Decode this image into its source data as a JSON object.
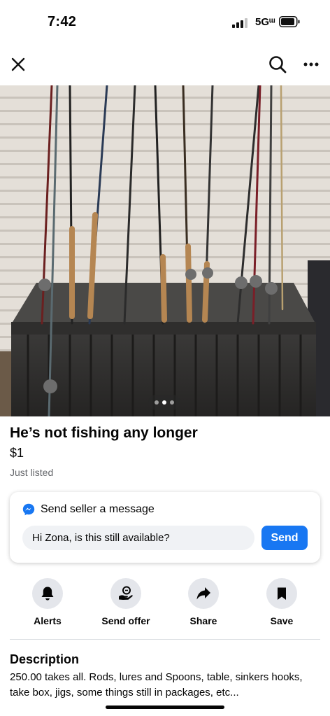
{
  "status_bar": {
    "time": "7:42",
    "network": "5Gᵚ",
    "signal_bars_active": 3,
    "signal_bars_total": 4
  },
  "nav": {
    "close_icon": "close-icon",
    "search_icon": "search-icon",
    "more_icon": "more-options-icon"
  },
  "photo": {
    "page_count": 3,
    "current_page": 2
  },
  "listing": {
    "title": "He’s not fishing any longer",
    "price": "$1",
    "listed": "Just listed"
  },
  "message": {
    "heading": "Send seller a message",
    "input_value": "Hi Zona, is this still available?",
    "send_label": "Send"
  },
  "actions": [
    {
      "label": "Alerts",
      "icon": "bell-icon"
    },
    {
      "label": "Send offer",
      "icon": "offer-icon"
    },
    {
      "label": "Share",
      "icon": "share-arrow-icon"
    },
    {
      "label": "Save",
      "icon": "bookmark-icon"
    }
  ],
  "description": {
    "heading": "Description",
    "text": "250.00 takes all. Rods, lures and Spoons, table, sinkers hooks, take box, jigs, some things still in packages, etc..."
  },
  "colors": {
    "accent": "#1877f2",
    "secondary_text": "#65676b",
    "action_bg": "#e4e6eb"
  }
}
